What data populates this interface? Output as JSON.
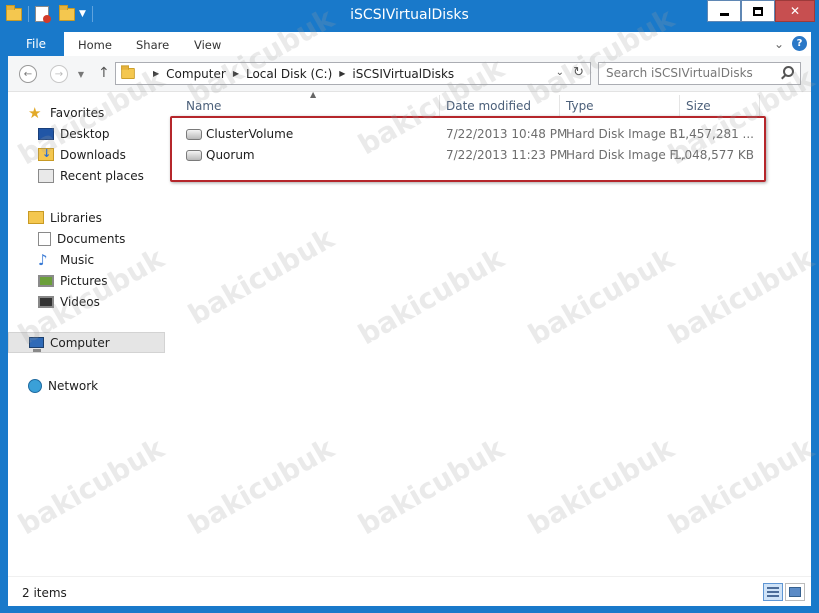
{
  "window": {
    "title": "iSCSIVirtualDisks"
  },
  "ribbon": {
    "file_tab": "File",
    "tabs": [
      "Home",
      "Share",
      "View"
    ]
  },
  "address": {
    "breadcrumbs": [
      "Computer",
      "Local Disk (C:)",
      "iSCSIVirtualDisks"
    ],
    "search_placeholder": "Search iSCSIVirtualDisks"
  },
  "nav": {
    "favorites": {
      "label": "Favorites",
      "items": [
        "Desktop",
        "Downloads",
        "Recent places"
      ]
    },
    "libraries": {
      "label": "Libraries",
      "items": [
        "Documents",
        "Music",
        "Pictures",
        "Videos"
      ]
    },
    "computer": "Computer",
    "network": "Network"
  },
  "columns": {
    "name": "Name",
    "date": "Date modified",
    "type": "Type",
    "size": "Size"
  },
  "files": [
    {
      "name": "ClusterVolume",
      "date": "7/22/2013 10:48 PM",
      "type": "Hard Disk Image F...",
      "size": "31,457,281 ..."
    },
    {
      "name": "Quorum",
      "date": "7/22/2013 11:23 PM",
      "type": "Hard Disk Image F...",
      "size": "1,048,577 KB"
    }
  ],
  "status": {
    "item_count": "2 items"
  },
  "watermark": "bakicubuk",
  "colors": {
    "chrome_blue": "#1979ca",
    "highlight_red": "#b5262b",
    "close_red": "#c74f50"
  }
}
